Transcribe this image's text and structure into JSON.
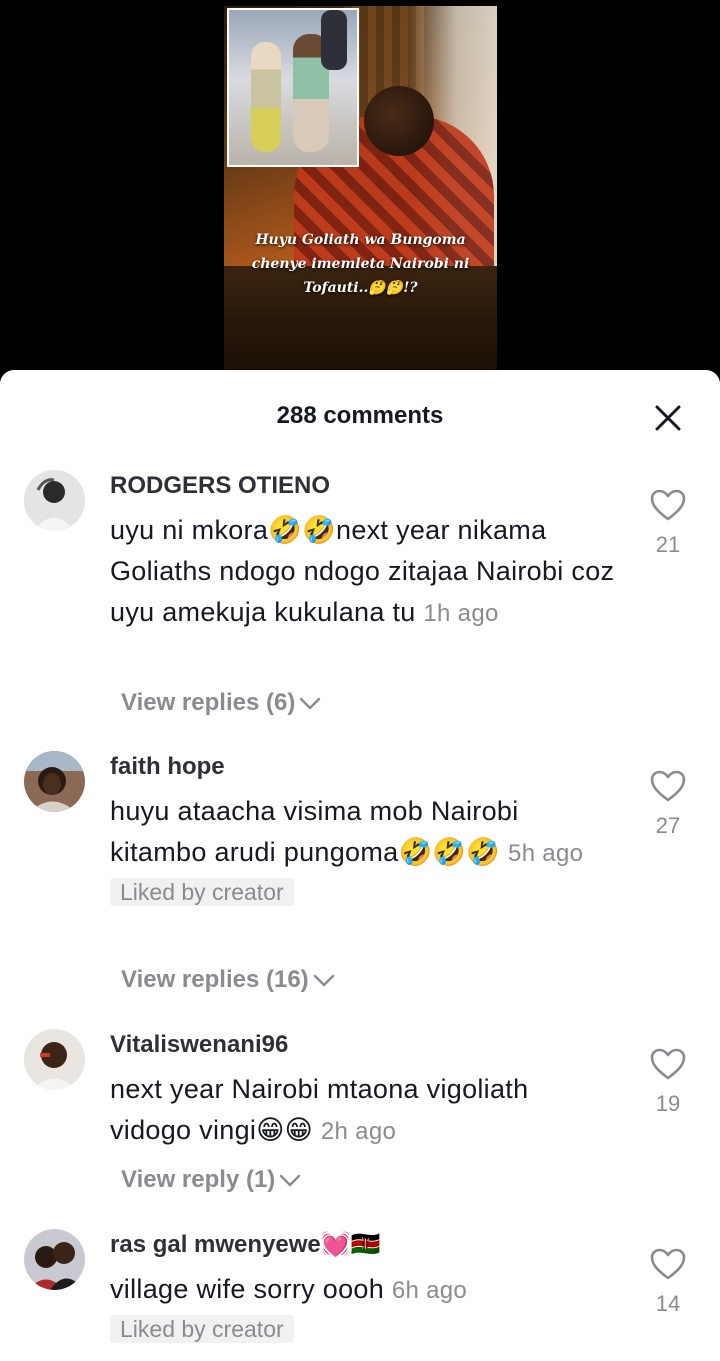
{
  "video": {
    "caption_lines": [
      "Huyu Goliath wa Bungoma",
      "chenye imemleta Nairobi ni",
      "Tofauti..🤔🤔!?"
    ]
  },
  "sheet": {
    "title": "288 comments",
    "close_icon": "close-icon"
  },
  "comments": [
    {
      "username": "RODGERS OTIENO",
      "text": "uyu ni mkora🤣🤣next year nikama Goliaths ndogo ndogo zitajaa Nairobi coz uyu amekuja kukulana tu",
      "time": "1h ago",
      "likes": "21",
      "replies": "View replies (6)",
      "liked_by_creator": ""
    },
    {
      "username": "faith hope",
      "text": "huyu ataacha visima mob Nairobi kitambo arudi pungoma🤣🤣🤣",
      "time": "5h ago",
      "likes": "27",
      "replies": "View replies (16)",
      "liked_by_creator": "Liked by creator"
    },
    {
      "username": "Vitaliswenani96",
      "text": "next year Nairobi mtaona vigoliath vidogo vingi😁😁",
      "time": "2h ago",
      "likes": "19",
      "replies": "View reply (1)",
      "liked_by_creator": ""
    },
    {
      "username": "ras gal mwenyewe💓🇰🇪",
      "text": "village wife sorry oooh",
      "time": "6h ago",
      "likes": "14",
      "replies": "",
      "liked_by_creator": "Liked by creator"
    }
  ],
  "colors": {
    "text_primary": "#161823",
    "text_secondary": "#8a8b91",
    "badge_bg": "#f1f1f2"
  }
}
